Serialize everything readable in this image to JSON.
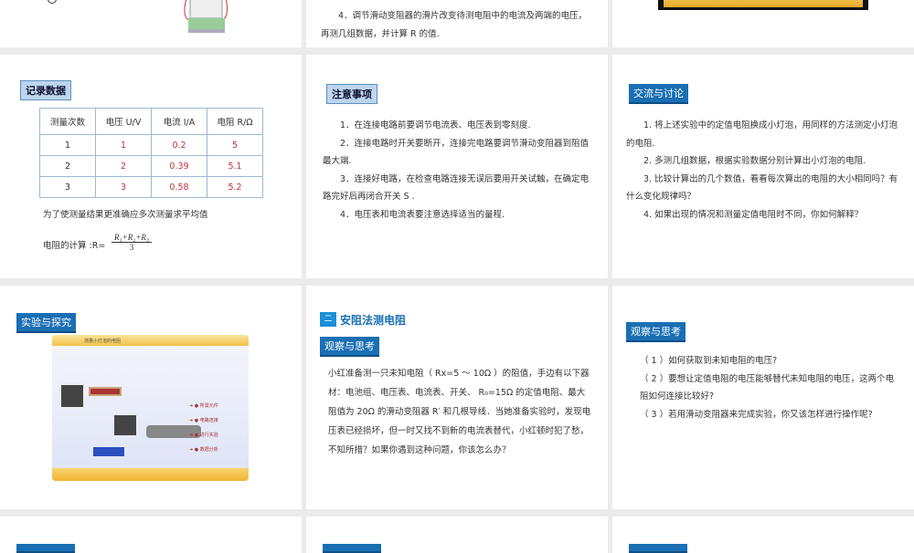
{
  "slides": {
    "s0b": {
      "step4": "4．调节滑动变阻器的滑片改变待测电阻中的电流及两端的电压，再测几组数据，并计算 R 的值."
    },
    "s1a": {
      "tag": "记录数据",
      "headers": [
        "测量次数",
        "电压 U/V",
        "电流 I/A",
        "电阻 R/Ω"
      ],
      "rows": [
        [
          "1",
          "1",
          "0.2",
          "5"
        ],
        [
          "2",
          "2",
          "0.39",
          "5.1"
        ],
        [
          "3",
          "3",
          "0.58",
          "5.2"
        ]
      ],
      "note": "为了使测量结果更准确应多次测量求平均值",
      "formula_label": "电阻的计算 :R=",
      "formula_num": "R₁+R₂+R₃",
      "formula_den": "3"
    },
    "s1b": {
      "tag": "注意事项",
      "items": [
        "1．在连接电路前要调节电流表、电压表到零刻度.",
        "2．连接电路时开关要断开，连接完电路要调节滑动变阻器到阻值最大端.",
        "3．连接好电路，在检查电路连接无误后要用开关试触，在确定电路完好后再闭合开关 S .",
        "4．电压表和电流表要注意选择适当的量程."
      ]
    },
    "s1c": {
      "tag": "交流与讨论",
      "items": [
        "1. 将上述实验中的定值电阻换成小灯泡，用同样的方法测定小灯泡的电阻.",
        "2. 多测几组数据，根据实验数据分别计算出小灯泡的电阻.",
        "3. 比较计算出的几个数值，看看每次算出的电阻的大小相同吗？有什么变化规律吗？",
        "4. 如果出现的情况和测量定值电阻时不同，你如何解释？"
      ]
    },
    "s2a": {
      "tag": "实验与探究",
      "image_title": "测量小灯泡的电阻",
      "menu": [
        "所需元件",
        "电路连接",
        "进行实验",
        "数据分析"
      ]
    },
    "s2b": {
      "section_num": "二",
      "section_title": "安阻法测电阻",
      "tag": "观察与思考",
      "text": "小红准备测一只未知电阻（ Rx=5 ～ 10Ω ）的阻值，手边有以下器材：电池组、电压表、电流表、开关、 R₀=15Ω 的定值电阻、最大阻值为 20Ω 的滑动变阻器 R′ 和几根导线．当她准备实验时，发现电压表已经损坏，但一时又找不到新的电流表替代，小红顿时犯了愁，不知所措？如果你遇到这种问题，你该怎么办？"
    },
    "s2c": {
      "tag": "观察与思考",
      "items": [
        "（ 1 ）如何获取到未知电阻的电压?",
        "（ 2 ）要想让定值电阻的电压能够替代未知电阻的电压，这两个电阻如何连接比较好?",
        "（ 3 ）若用滑动变阻器来完成实验，你又该怎样进行操作呢?"
      ]
    }
  }
}
